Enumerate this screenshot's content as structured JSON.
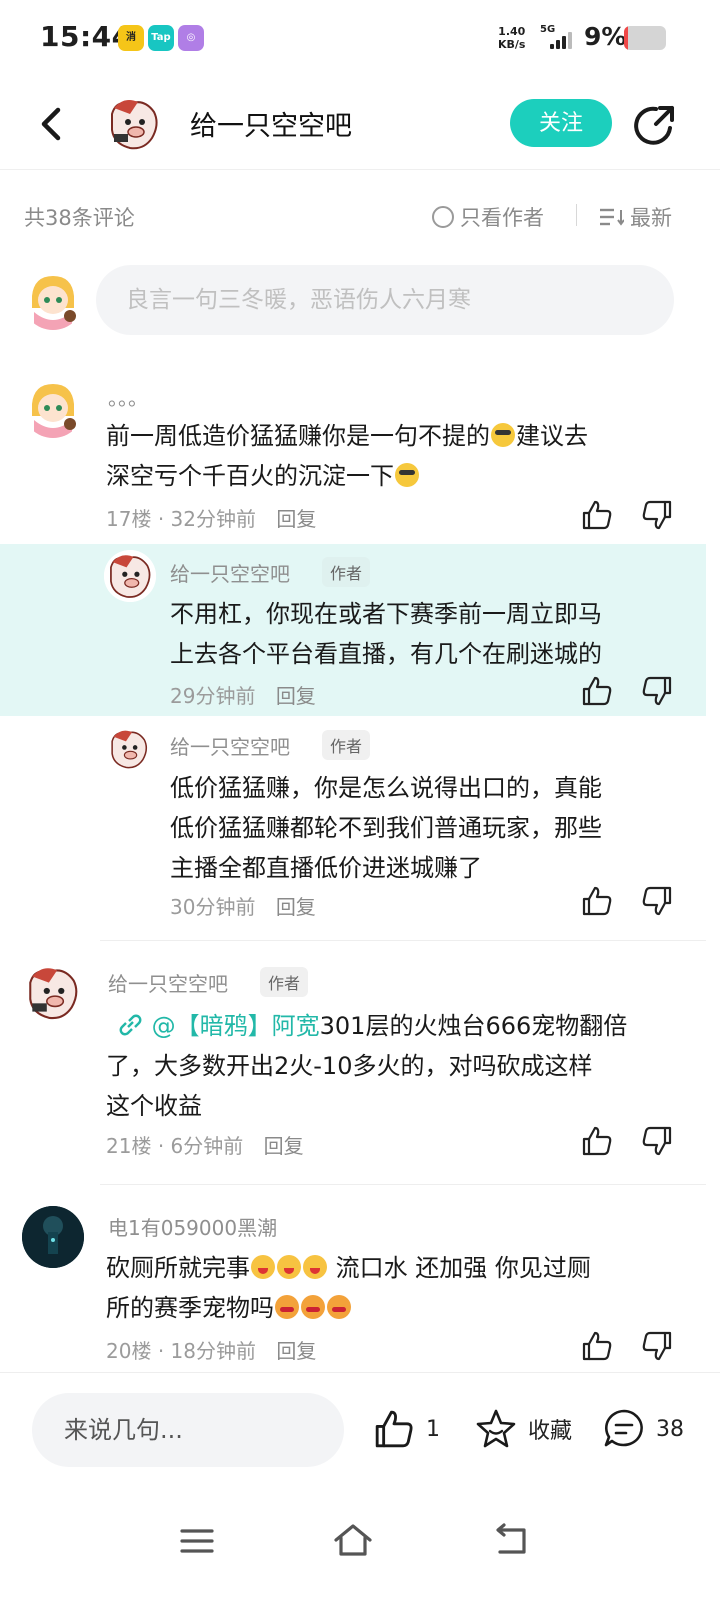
{
  "status_bar": {
    "time": "15:44",
    "app_badges": [
      {
        "name": "app-badge-yellow",
        "text": "消",
        "color": "#f5c518"
      },
      {
        "name": "app-badge-taptap",
        "text": "Tap",
        "color": "#18c6c2"
      },
      {
        "name": "app-badge-purple",
        "text": "◎",
        "color": "#b07ee6"
      }
    ],
    "net_speed_value": "1.40",
    "net_speed_unit": "KB/s",
    "network": "5G",
    "battery_percent": "9%",
    "battery_level": 0.09
  },
  "header": {
    "title": "给一只空空吧",
    "follow_label": "关注"
  },
  "summary": {
    "count_label": "共38条评论",
    "only_author_label": "只看作者",
    "sort_label": "最新"
  },
  "comment_input": {
    "placeholder": "良言一句三冬暖，恶语伤人六月寒"
  },
  "comments": [
    {
      "name": "。。。",
      "text_lines": [
        "前一周低造价猛猛赚你是一句不提的",
        "建议去",
        "深空亏个千百火的沉淀一下"
      ],
      "floor": "17楼",
      "time": "32分钟前",
      "reply": "回复"
    },
    {
      "name": "给一只空空吧",
      "tag": "作者",
      "text_lines": [
        "不用杠，你现在或者下赛季前一周立即马",
        "上去各个平台看直播，有几个在刷迷城的"
      ],
      "time": "29分钟前",
      "reply": "回复"
    },
    {
      "name": "给一只空空吧",
      "tag": "作者",
      "text_lines": [
        "低价猛猛赚，你是怎么说得出口的，真能",
        "低价猛猛赚都轮不到我们普通玩家，那些",
        "主播全都直播低价进迷城赚了"
      ],
      "time": "30分钟前",
      "reply": "回复"
    },
    {
      "name": "给一只空空吧",
      "tag": "作者",
      "mention": "@【暗鸦】阿宽",
      "text_lines": [
        "301层的火烛台666宠物翻倍",
        "了，大多数开出2火-10多火的，对吗砍成这样",
        "这个收益"
      ],
      "floor": "21楼",
      "time": "6分钟前",
      "reply": "回复"
    },
    {
      "name": "电1有059000黑潮",
      "text_lines": [
        "砍厕所就完事",
        "流口水 还加强 你见过厕",
        "所的赛季宠物吗"
      ],
      "floor": "20楼",
      "time": "18分钟前",
      "reply": "回复"
    }
  ],
  "meta_separator": "·",
  "bottom_bar": {
    "placeholder": "来说几句...",
    "like_count": "1",
    "favorite_label": "收藏",
    "comment_count": "38"
  },
  "colors": {
    "accent": "#1ccfbd",
    "highlight": "#e3f7f5",
    "link": "#22b8a8"
  }
}
